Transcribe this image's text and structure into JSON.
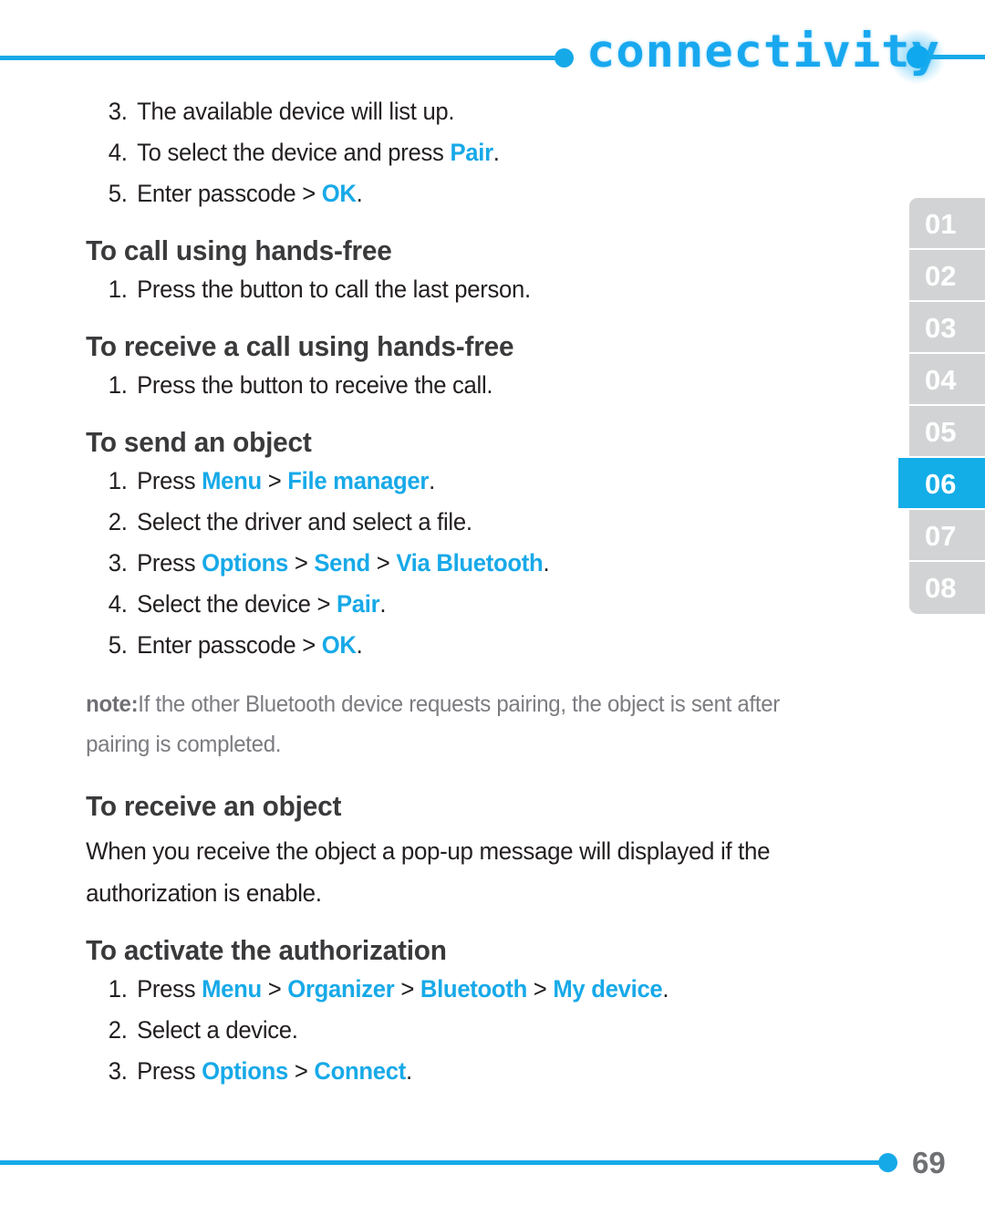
{
  "header": {
    "title": "connectivity",
    "left_dot": "bullet-dot",
    "right_dot": "bullet-dot-glow",
    "accent_color": "#16a9e8"
  },
  "colors": {
    "accent_blue": "#17a9e8",
    "tab_blue": "#13ade8",
    "tab_gray": "#d2d3d4",
    "heading_gray": "#3a3a3c",
    "body_black": "#231f20",
    "note_gray": "#7b7b80",
    "page_number_gray": "#6f7073"
  },
  "intro_steps": [
    {
      "num": "3.",
      "parts": [
        {
          "t": "The available device will list up.",
          "s": "plain"
        }
      ]
    },
    {
      "num": "4.",
      "parts": [
        {
          "t": "To select the device and press ",
          "s": "plain"
        },
        {
          "t": "Pair",
          "s": "kw"
        },
        {
          "t": ".",
          "s": "plain"
        }
      ]
    },
    {
      "num": "5.",
      "parts": [
        {
          "t": "Enter passcode ",
          "s": "plain"
        },
        {
          "t": ">",
          "s": "sep"
        },
        {
          "t": " ",
          "s": "plain"
        },
        {
          "t": "OK",
          "s": "kw"
        },
        {
          "t": ".",
          "s": "plain"
        }
      ]
    }
  ],
  "sections": [
    {
      "heading": "To call using hands-free",
      "steps": [
        {
          "num": "1.",
          "parts": [
            {
              "t": "Press the button to call the last person.",
              "s": "plain"
            }
          ]
        }
      ]
    },
    {
      "heading": "To receive a call using hands-free",
      "steps": [
        {
          "num": "1.",
          "parts": [
            {
              "t": "Press the button to receive the call.",
              "s": "plain"
            }
          ]
        }
      ]
    },
    {
      "heading": "To send an object",
      "steps": [
        {
          "num": "1.",
          "parts": [
            {
              "t": "Press ",
              "s": "plain"
            },
            {
              "t": "Menu",
              "s": "kw"
            },
            {
              "t": " > ",
              "s": "sep"
            },
            {
              "t": "File manager",
              "s": "kw"
            },
            {
              "t": ".",
              "s": "plain"
            }
          ]
        },
        {
          "num": "2.",
          "parts": [
            {
              "t": "Select the driver and select a file.",
              "s": "plain"
            }
          ]
        },
        {
          "num": "3.",
          "parts": [
            {
              "t": "Press ",
              "s": "plain"
            },
            {
              "t": "Options",
              "s": "kw"
            },
            {
              "t": " > ",
              "s": "sep"
            },
            {
              "t": "Send",
              "s": "kw"
            },
            {
              "t": " > ",
              "s": "sep"
            },
            {
              "t": "Via Bluetooth",
              "s": "kw"
            },
            {
              "t": ".",
              "s": "plain"
            }
          ]
        },
        {
          "num": "4.",
          "parts": [
            {
              "t": "Select the device ",
              "s": "plain"
            },
            {
              "t": ">",
              "s": "sep"
            },
            {
              "t": " ",
              "s": "plain"
            },
            {
              "t": "Pair",
              "s": "kw"
            },
            {
              "t": ".",
              "s": "plain"
            }
          ]
        },
        {
          "num": "5.",
          "parts": [
            {
              "t": "Enter passcode ",
              "s": "plain"
            },
            {
              "t": ">",
              "s": "sep"
            },
            {
              "t": " ",
              "s": "plain"
            },
            {
              "t": "OK",
              "s": "kw"
            },
            {
              "t": ".",
              "s": "plain"
            }
          ]
        }
      ]
    }
  ],
  "note": {
    "label": "note:",
    "text": "If the other Bluetooth device requests pairing, the object is sent after pairing is completed."
  },
  "receive_section": {
    "heading": "To receive an object",
    "paragraph": "When you receive the object a pop-up message will displayed if the authorization is enable."
  },
  "authorization_section": {
    "heading": "To activate the authorization",
    "steps": [
      {
        "num": "1.",
        "parts": [
          {
            "t": "Press ",
            "s": "plain"
          },
          {
            "t": "Menu",
            "s": "kw"
          },
          {
            "t": " > ",
            "s": "sep"
          },
          {
            "t": "Organizer",
            "s": "kw"
          },
          {
            "t": " > ",
            "s": "sep"
          },
          {
            "t": "Bluetooth",
            "s": "kw"
          },
          {
            "t": " > ",
            "s": "sep"
          },
          {
            "t": "My device",
            "s": "kw"
          },
          {
            "t": ".",
            "s": "plain"
          }
        ]
      },
      {
        "num": "2.",
        "parts": [
          {
            "t": "Select a device.",
            "s": "plain"
          }
        ]
      },
      {
        "num": "3.",
        "parts": [
          {
            "t": "Press ",
            "s": "plain"
          },
          {
            "t": "Options",
            "s": "kw"
          },
          {
            "t": " > ",
            "s": "sep"
          },
          {
            "t": "Connect",
            "s": "kw"
          },
          {
            "t": ".",
            "s": "plain"
          }
        ]
      }
    ]
  },
  "tabs": [
    {
      "label": "01",
      "active": false
    },
    {
      "label": "02",
      "active": false
    },
    {
      "label": "03",
      "active": false
    },
    {
      "label": "04",
      "active": false
    },
    {
      "label": "05",
      "active": false
    },
    {
      "label": "06",
      "active": true
    },
    {
      "label": "07",
      "active": false
    },
    {
      "label": "08",
      "active": false
    }
  ],
  "footer": {
    "page_number": "69",
    "dot": "bullet-dot"
  }
}
